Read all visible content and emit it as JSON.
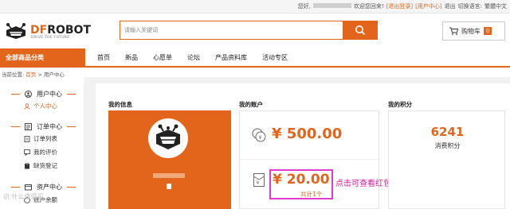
{
  "topbar": {
    "greeting_prefix": "您好,",
    "greeting_suffix": "欢迎您回来!",
    "logout_link": "[退出登录]",
    "user_center_link": "[用户中心]",
    "exit_link": "退出",
    "language_label": "切换语言:",
    "language_value": "繁體中文"
  },
  "header": {
    "brand_prefix": "DF",
    "brand_suffix": "ROBOT",
    "tagline": "DRIVE THE FUTURE",
    "search_placeholder": "请输入关键词",
    "cart_label": "购物车",
    "cart_count": "0"
  },
  "nav": {
    "all_categories": "全部商品分类",
    "items": [
      "首页",
      "新品",
      "心愿单",
      "论坛",
      "产品资料库",
      "活动专区"
    ]
  },
  "breadcrumb": {
    "prefix": "当前位置:",
    "home": "首页",
    "separator": ">",
    "current": "用户中心"
  },
  "sidebar": {
    "sections": [
      {
        "title": "用户中心",
        "items": [
          "个人中心"
        ]
      },
      {
        "title": "订单中心",
        "items": [
          "订单列表",
          "我的评价",
          "缺货登记"
        ]
      },
      {
        "title": "资产中心",
        "items": [
          "账户余额"
        ]
      }
    ]
  },
  "main": {
    "info_title": "我的信息",
    "account_title": "我的账户",
    "points_title": "我的积分",
    "balance": "¥ 500.00",
    "red_packet": "¥ 20.00",
    "red_packet_count": "共计1个",
    "points_value": "6241",
    "points_label": "消费积分",
    "annotation": "点击可查看红包使用详情"
  },
  "watermark": "识 什么值得买",
  "colors": {
    "accent": "#e2651b",
    "highlight": "#e23bd0",
    "annotation": "#d11a9a"
  }
}
